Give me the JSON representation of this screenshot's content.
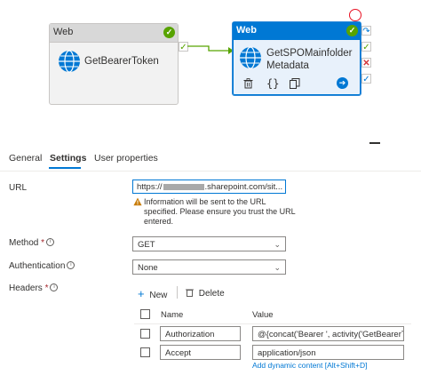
{
  "canvas": {
    "node1": {
      "type_label": "Web",
      "name": "GetBearerToken"
    },
    "node2": {
      "type_label": "Web",
      "name_line1": "GetSPOMainfolder",
      "name_line2": "Metadata"
    },
    "icons": {
      "success": "check-icon",
      "failure": "cross-icon",
      "completion": "check-icon",
      "delete": "trash-icon",
      "code": "braces-icon",
      "copy": "copy-icon",
      "navigate": "arrow-right-icon"
    }
  },
  "tabs": [
    "General",
    "Settings",
    "User properties"
  ],
  "active_tab": "Settings",
  "form": {
    "url": {
      "label": "URL",
      "value_prefix": "https://",
      "value_suffix": ".sharepoint.com/sit...",
      "warning": "Information will be sent to the URL specified. Please ensure you trust the URL entered."
    },
    "method": {
      "label": "Method",
      "value": "GET"
    },
    "authentication": {
      "label": "Authentication",
      "value": "None"
    },
    "headers": {
      "label": "Headers",
      "new_label": "New",
      "delete_label": "Delete",
      "col_name": "Name",
      "col_value": "Value",
      "rows": [
        {
          "name": "Authorization",
          "value": "@{concat('Bearer ', activity('GetBearerT..."
        },
        {
          "name": "Accept",
          "value": "application/json"
        }
      ],
      "dynamic_link": "Add dynamic content [Alt+Shift+D]"
    }
  },
  "colors": {
    "accent": "#0078d4",
    "success": "#57a300",
    "error": "#d13438",
    "required": "#a4262c"
  }
}
